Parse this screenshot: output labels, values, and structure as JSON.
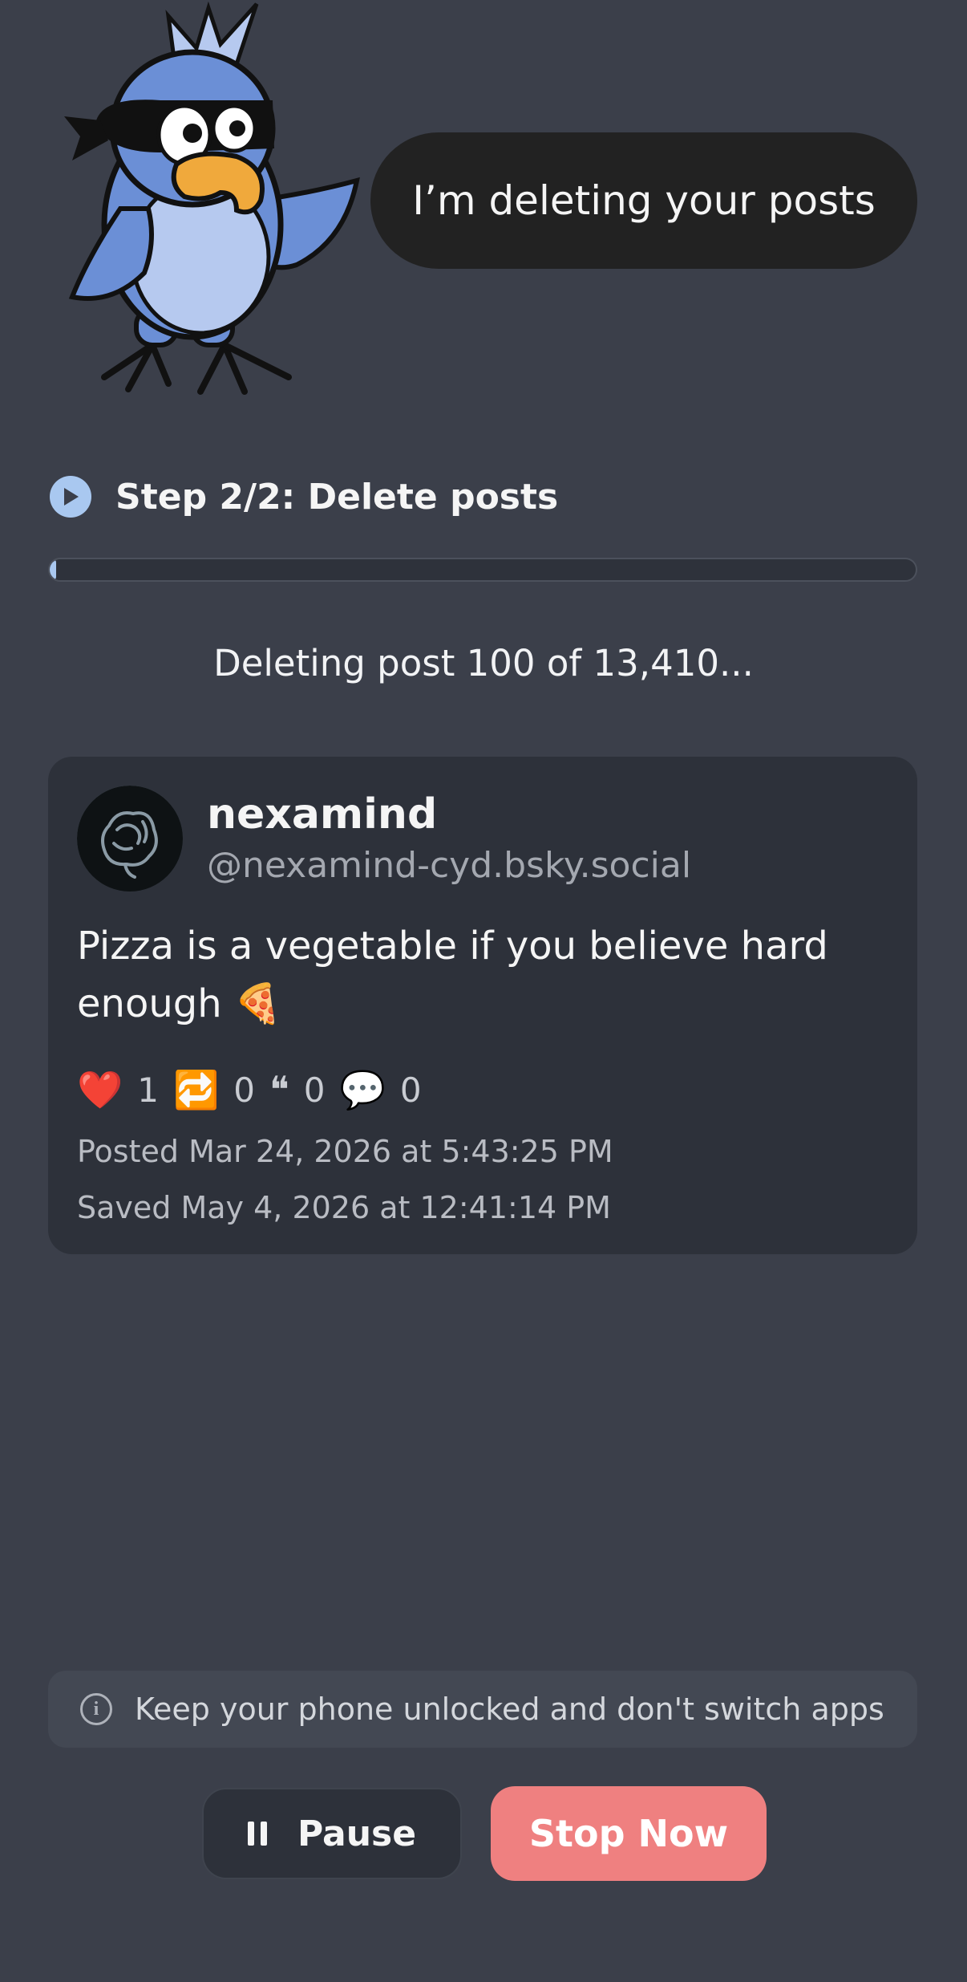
{
  "speech_bubble": {
    "text": "I’m deleting your posts"
  },
  "step": {
    "label": "Step 2/2: Delete posts",
    "icon": "play-circle-icon"
  },
  "progress": {
    "current": 100,
    "total": 13410,
    "fraction": 0.0075
  },
  "status": {
    "text": "Deleting post 100 of 13,410..."
  },
  "post": {
    "display_name": "nexamind",
    "handle": "@nexamind-cyd.bsky.social",
    "text": "Pizza is a vegetable if you believe hard enough 🍕",
    "stats": {
      "likes_icon": "❤️",
      "likes": "1",
      "reposts_icon": "🔁",
      "reposts": "0",
      "quotes_icon": "❝",
      "quotes": "0",
      "replies_icon": "💬",
      "replies": "0"
    },
    "posted": "Posted Mar 24, 2026 at 5:43:25 PM",
    "saved": "Saved May 4, 2026 at 12:41:14 PM"
  },
  "notice": {
    "text": "Keep your phone unlocked and don't switch apps",
    "icon": "info-icon"
  },
  "buttons": {
    "pause": "Pause",
    "stop": "Stop Now"
  },
  "colors": {
    "background": "#3b3f4a",
    "card": "#2d313a",
    "accent": "#a9c8f0",
    "stop": "#ef8080",
    "bubble": "#222222"
  }
}
